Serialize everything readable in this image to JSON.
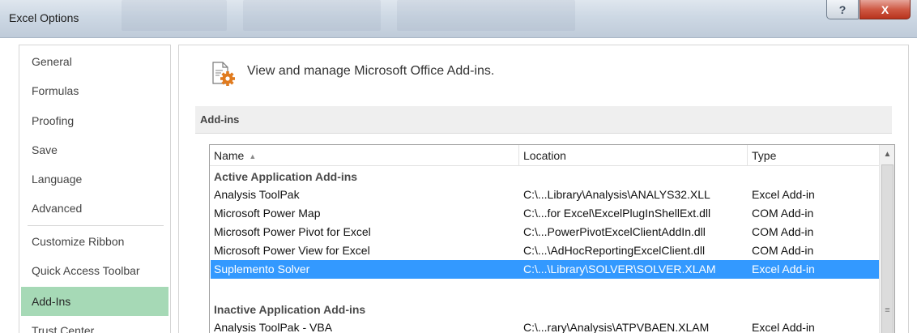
{
  "window": {
    "title": "Excel Options",
    "help_label": "?",
    "close_label": "X"
  },
  "nav": {
    "items": [
      {
        "label": "General"
      },
      {
        "label": "Formulas"
      },
      {
        "label": "Proofing"
      },
      {
        "label": "Save"
      },
      {
        "label": "Language"
      },
      {
        "label": "Advanced"
      },
      {
        "label": "Customize Ribbon"
      },
      {
        "label": "Quick Access Toolbar"
      },
      {
        "label": "Add-Ins"
      },
      {
        "label": "Trust Center"
      }
    ],
    "selected": "Add-Ins"
  },
  "main": {
    "heading": "View and manage Microsoft Office Add-ins.",
    "icon": "addins-gear-icon",
    "section_title": "Add-ins"
  },
  "table": {
    "columns": {
      "name": "Name",
      "name_sort": "▲",
      "location": "Location",
      "type": "Type"
    },
    "groups": [
      {
        "title": "Active Application Add-ins",
        "rows": [
          {
            "name": "Analysis ToolPak",
            "location": "C:\\...Library\\Analysis\\ANALYS32.XLL",
            "type": "Excel Add-in"
          },
          {
            "name": "Microsoft Power Map",
            "location": "C:\\...for Excel\\ExcelPlugInShellExt.dll",
            "type": "COM Add-in"
          },
          {
            "name": "Microsoft Power Pivot for Excel",
            "location": "C:\\...PowerPivotExcelClientAddIn.dll",
            "type": "COM Add-in"
          },
          {
            "name": "Microsoft Power View for Excel",
            "location": "C:\\...\\AdHocReportingExcelClient.dll",
            "type": "COM Add-in"
          },
          {
            "name": "Suplemento Solver",
            "location": "C:\\...\\Library\\SOLVER\\SOLVER.XLAM",
            "type": "Excel Add-in"
          }
        ]
      },
      {
        "title": "Inactive Application Add-ins",
        "rows": [
          {
            "name": "Analysis ToolPak - VBA",
            "location": "C:\\...rary\\Analysis\\ATPVBAEN.XLAM",
            "type": "Excel Add-in"
          }
        ]
      }
    ],
    "selected_row": "Suplemento Solver"
  },
  "colors": {
    "nav_selected": "#a6d9b6",
    "row_selected": "#3399ff",
    "close_button": "#c9452f",
    "icon_orange": "#e07b1f"
  }
}
